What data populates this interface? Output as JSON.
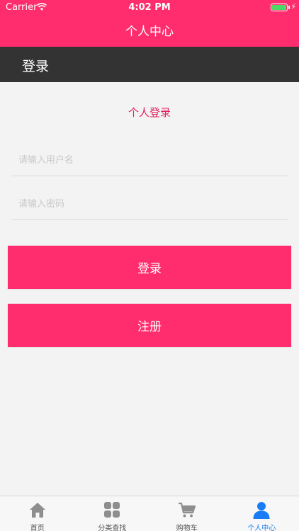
{
  "status_bar": {
    "carrier": "Carrier",
    "time": "4:02 PM",
    "battery_level": 1.0
  },
  "nav": {
    "title": "个人中心"
  },
  "section": {
    "label": "登录"
  },
  "login": {
    "title": "个人登录",
    "username_placeholder": "请输入用户名",
    "password_placeholder": "请输入密码",
    "login_button": "登录",
    "register_button": "注册"
  },
  "tabs": [
    {
      "label": "首页",
      "icon": "home-icon",
      "active": false
    },
    {
      "label": "分类查找",
      "icon": "grid-icon",
      "active": false
    },
    {
      "label": "购物车",
      "icon": "cart-icon",
      "active": false
    },
    {
      "label": "个人中心",
      "icon": "person-icon",
      "active": true
    }
  ],
  "colors": {
    "accent": "#ff2d6d",
    "section_bar": "#333333",
    "tab_active": "#1a7cf5",
    "tab_inactive": "#8e8e8e"
  }
}
